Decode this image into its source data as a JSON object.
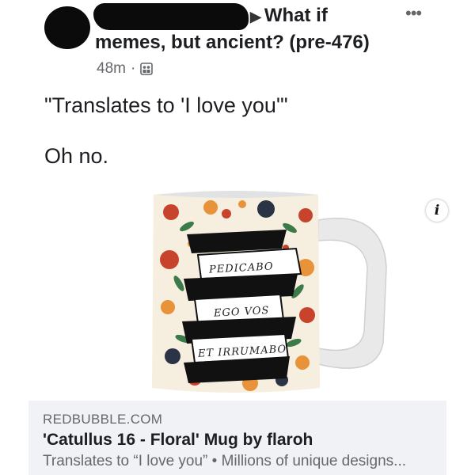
{
  "post": {
    "author_redacted": true,
    "group_arrow": "▶",
    "group_name_line1": "What if",
    "group_name_line2": "memes, but ancient? (pre-476)",
    "time": "48m",
    "separator": "·",
    "audience_icon": "group-icon",
    "more_icon": "•••",
    "text_line1": "\"Translates to 'I love you'\"",
    "text_line2": "Oh no."
  },
  "link_preview": {
    "image": {
      "subject": "mug-image",
      "ribbon_texts": [
        "PEDICABO",
        "EGO VOS",
        "ET IRRUMABO"
      ],
      "info_icon": "i"
    },
    "domain": "REDBUBBLE.COM",
    "title": "'Catullus 16 - Floral' Mug by flaroh",
    "description": "Translates to “I love you” • Millions of unique designs..."
  },
  "colors": {
    "redaction": "#0b0b0b",
    "muted_text": "#65676b",
    "footer_bg": "#f0f2f5",
    "mug_base": "#f6efe0",
    "flower_red": "#c8432b",
    "flower_orange": "#e8923a",
    "leaf_green": "#3d7a4a",
    "flower_navy": "#2b3346"
  }
}
